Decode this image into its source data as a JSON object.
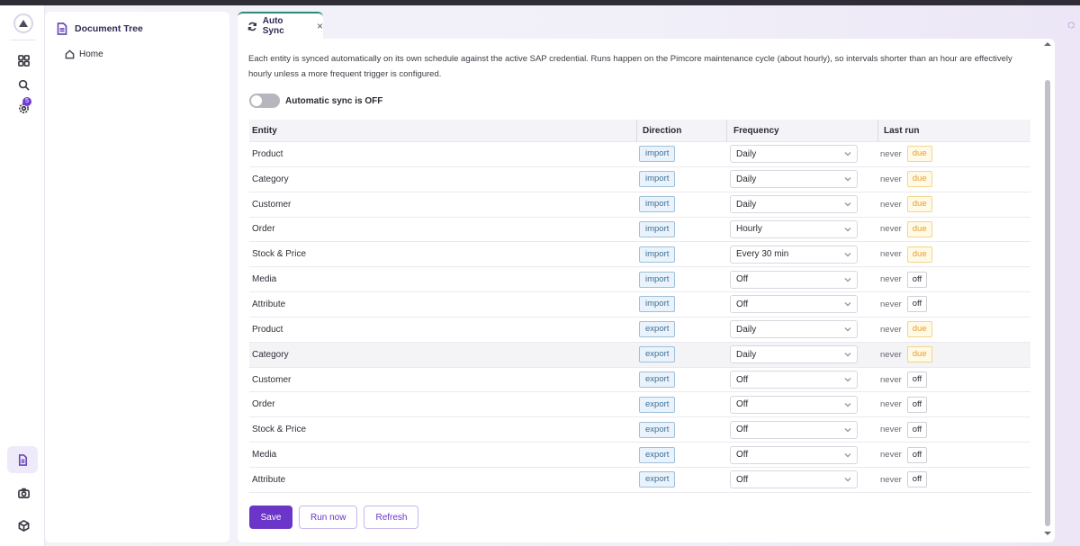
{
  "rail": {
    "badge_count": "5",
    "icons": [
      "app-logo-icon",
      "grid-icon",
      "search-icon",
      "gear-icon",
      "document-icon",
      "camera-icon",
      "cube-icon"
    ]
  },
  "tree": {
    "title": "Document Tree",
    "items": [
      {
        "label": "Home"
      }
    ]
  },
  "tab": {
    "label": "Auto Sync",
    "close": "×"
  },
  "description": "Each entity is synced automatically on its own schedule against the active SAP credential. Runs happen on the Pimcore maintenance cycle (about hourly), so intervals shorter than an hour are effectively hourly unless a more frequent trigger is configured.",
  "toggle": {
    "label": "Automatic sync is OFF",
    "state": "off"
  },
  "table": {
    "headers": {
      "entity": "Entity",
      "direction": "Direction",
      "frequency": "Frequency",
      "last_run": "Last run"
    },
    "rows": [
      {
        "entity": "Product",
        "direction": "import",
        "frequency": "Daily",
        "last": "never",
        "status": "due"
      },
      {
        "entity": "Category",
        "direction": "import",
        "frequency": "Daily",
        "last": "never",
        "status": "due"
      },
      {
        "entity": "Customer",
        "direction": "import",
        "frequency": "Daily",
        "last": "never",
        "status": "due"
      },
      {
        "entity": "Order",
        "direction": "import",
        "frequency": "Hourly",
        "last": "never",
        "status": "due"
      },
      {
        "entity": "Stock & Price",
        "direction": "import",
        "frequency": "Every 30 min",
        "last": "never",
        "status": "due"
      },
      {
        "entity": "Media",
        "direction": "import",
        "frequency": "Off",
        "last": "never",
        "status": "off"
      },
      {
        "entity": "Attribute",
        "direction": "import",
        "frequency": "Off",
        "last": "never",
        "status": "off"
      },
      {
        "entity": "Product",
        "direction": "export",
        "frequency": "Daily",
        "last": "never",
        "status": "due"
      },
      {
        "entity": "Category",
        "direction": "export",
        "frequency": "Daily",
        "last": "never",
        "status": "due"
      },
      {
        "entity": "Customer",
        "direction": "export",
        "frequency": "Off",
        "last": "never",
        "status": "off"
      },
      {
        "entity": "Order",
        "direction": "export",
        "frequency": "Off",
        "last": "never",
        "status": "off"
      },
      {
        "entity": "Stock & Price",
        "direction": "export",
        "frequency": "Off",
        "last": "never",
        "status": "off"
      },
      {
        "entity": "Media",
        "direction": "export",
        "frequency": "Off",
        "last": "never",
        "status": "off"
      },
      {
        "entity": "Attribute",
        "direction": "export",
        "frequency": "Off",
        "last": "never",
        "status": "off"
      }
    ]
  },
  "buttons": {
    "save": "Save",
    "run_now": "Run now",
    "refresh": "Refresh"
  },
  "colors": {
    "accent": "#6b35c9",
    "tab_indicator": "#2e8b7a",
    "due": "#e1a233",
    "direction": "#3e6e96"
  }
}
